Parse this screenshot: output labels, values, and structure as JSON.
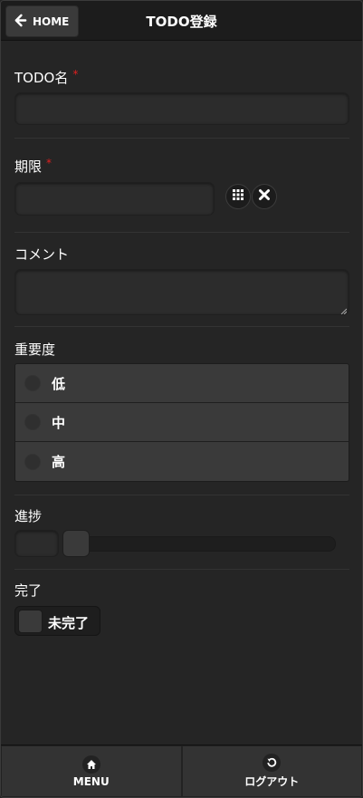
{
  "header": {
    "back_label": "HOME",
    "title": "TODO登録"
  },
  "form": {
    "name": {
      "label": "TODO名",
      "required_mark": "*",
      "value": ""
    },
    "deadline": {
      "label": "期限",
      "required_mark": "*",
      "value": ""
    },
    "comment": {
      "label": "コメント",
      "value": ""
    },
    "priority": {
      "label": "重要度",
      "options": [
        "低",
        "中",
        "高"
      ]
    },
    "progress": {
      "label": "進捗",
      "value": "",
      "level": 0
    },
    "done": {
      "label": "完了",
      "state_label": "未完了"
    }
  },
  "footer": {
    "menu_label": "MENU",
    "logout_label": "ログアウト"
  },
  "colors": {
    "background": "#252525",
    "required": "#e02020"
  }
}
